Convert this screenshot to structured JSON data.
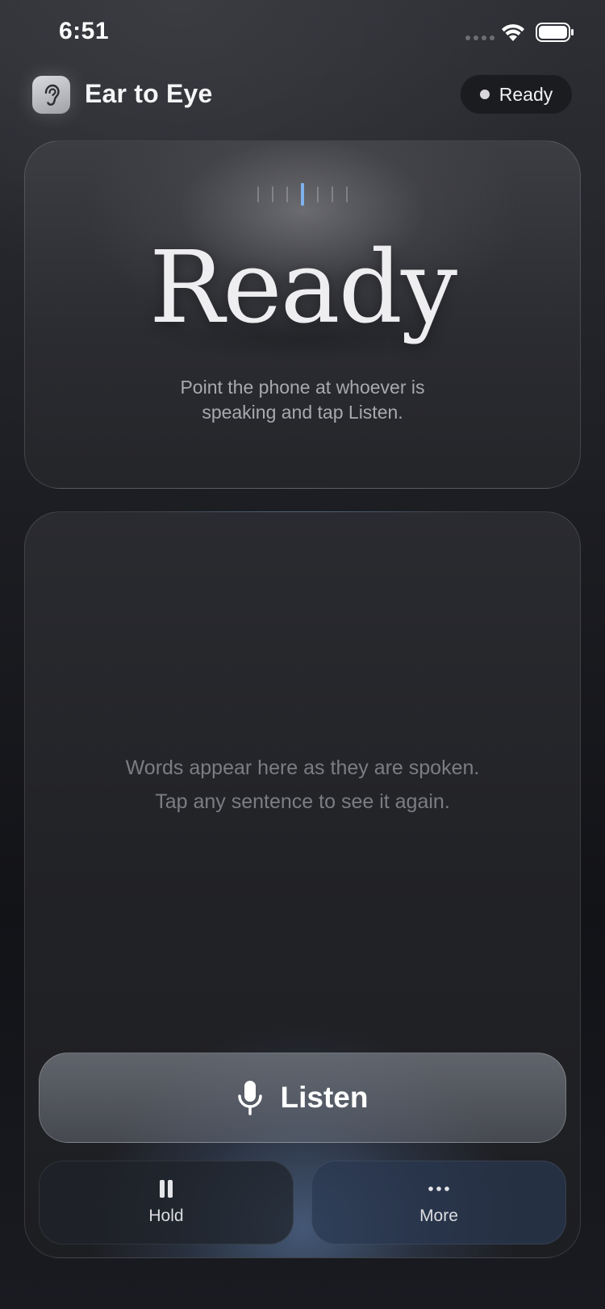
{
  "status_bar": {
    "time": "6:51"
  },
  "header": {
    "app_title": "Ear to Eye",
    "status_label": "Ready",
    "logo_icon": "ear-icon"
  },
  "ready_card": {
    "headline": "Ready",
    "subtitle_line1": "Point the phone at whoever is",
    "subtitle_line2": "speaking and tap Listen.",
    "meter_bars": 7,
    "meter_active_index": 3,
    "meter_active_color": "#7fb2ec"
  },
  "transcript": {
    "empty_line1": "Words appear here as they are spoken.",
    "empty_line2": "Tap any sentence to see it again."
  },
  "controls": {
    "listen_label": "Listen",
    "listen_icon": "microphone-icon",
    "hold_label": "Hold",
    "hold_icon": "pause-icon",
    "more_label": "More",
    "more_icon": "ellipsis-icon"
  }
}
